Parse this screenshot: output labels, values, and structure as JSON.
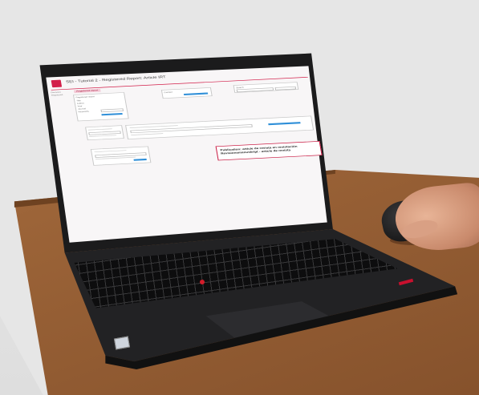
{
  "app": {
    "title": "SEI - Tutorial 2 - Registered Report: Article IRT",
    "tab_label": "Registered report"
  },
  "sidebar": {
    "items": [
      "Overview",
      "Registered"
    ]
  },
  "form": {
    "sections": [
      "Registered report",
      "Contact",
      "Search"
    ],
    "fields": [
      "Title",
      "Author",
      "Year",
      "Journal",
      "Keywords"
    ],
    "action_label": "Submit"
  },
  "note": {
    "text": "Publication: article de revista en revistación Revisionsmanuskript - article de revista"
  },
  "colors": {
    "brand": "#d21f4a",
    "accent": "#2f8fd8",
    "trackpoint": "#d21c2a"
  }
}
